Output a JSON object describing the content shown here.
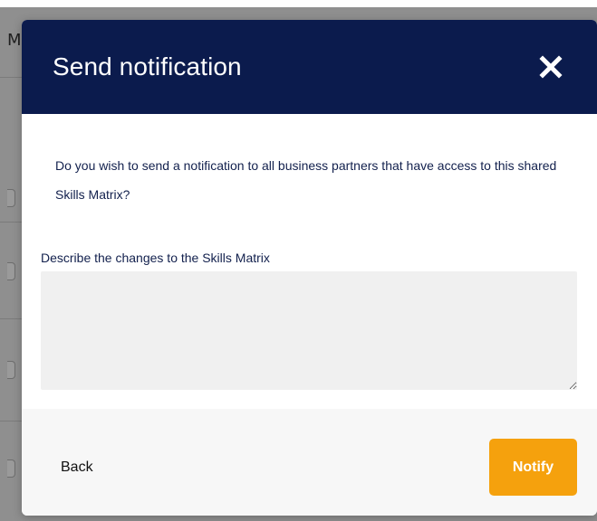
{
  "background": {
    "partial_letter": "M"
  },
  "modal": {
    "title": "Send notification",
    "close_icon": "close-icon",
    "question": "Do you wish to send a notification to all business partners that have access to this shared Skills Matrix?",
    "field_label": "Describe the changes to the Skills Matrix",
    "textarea_value": "",
    "textarea_placeholder": "",
    "back_label": "Back",
    "notify_label": "Notify"
  },
  "colors": {
    "header_bg": "#0b1b4d",
    "accent": "#f5a10d",
    "text": "#12204d",
    "textarea_bg": "#f0f0f0",
    "overlay": "#8f8f8f"
  }
}
